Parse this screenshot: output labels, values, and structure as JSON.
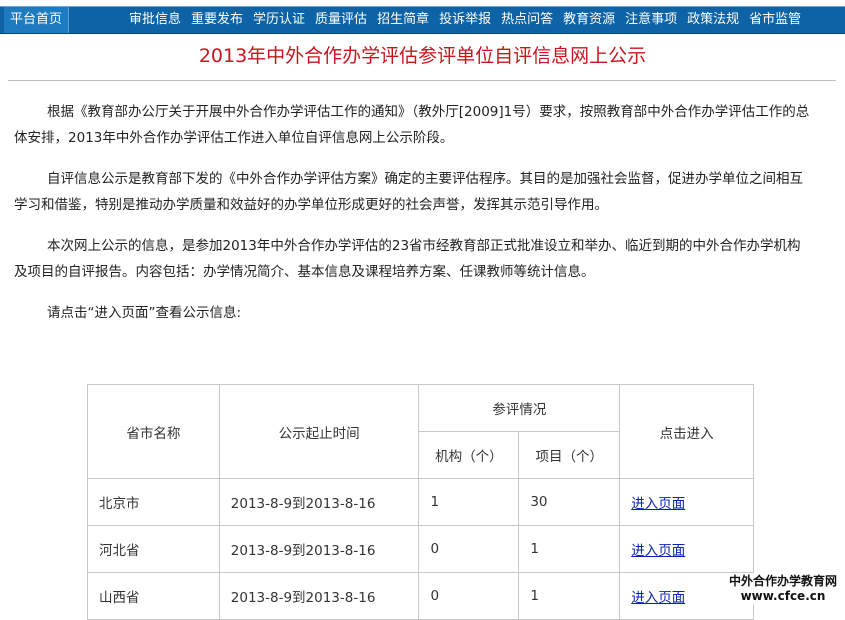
{
  "nav": {
    "home": "平台首页",
    "items": [
      "审批信息",
      "重要发布",
      "学历认证",
      "质量评估",
      "招生简章",
      "投诉举报",
      "热点问答",
      "教育资源",
      "注意事项",
      "政策法规",
      "省市监管"
    ]
  },
  "title": "2013年中外合作办学评估参评单位自评信息网上公示",
  "paragraphs": [
    "根据《教育部办公厅关于开展中外合作办学评估工作的通知》（教外厅[2009]1号）要求，按照教育部中外合作办学评估工作的总体安排，2013年中外合作办学评估工作进入单位自评信息网上公示阶段。",
    "自评信息公示是教育部下发的《中外合作办学评估方案》确定的主要评估程序。其目的是加强社会监督，促进办学单位之间相互学习和借鉴，特别是推动办学质量和效益好的办学单位形成更好的社会声誉，发挥其示范引导作用。",
    "本次网上公示的信息，是参加2013年中外合作办学评估的23省市经教育部正式批准设立和举办、临近到期的中外合作办学机构及项目的自评报告。内容包括：办学情况简介、基本信息及课程培养方案、任课教师等统计信息。",
    "请点击“进入页面”查看公示信息:"
  ],
  "table": {
    "header": {
      "province": "省市名称",
      "period": "公示起止时间",
      "participation": "参评情况",
      "institutions": "机构（个）",
      "projects": "项目（个）",
      "enter": "点击进入"
    },
    "rows": [
      {
        "province": "北京市",
        "period": "2013-8-9到2013-8-16",
        "institutions": "1",
        "projects": "30",
        "link": "进入页面"
      },
      {
        "province": "河北省",
        "period": "2013-8-9到2013-8-16",
        "institutions": "0",
        "projects": "1",
        "link": "进入页面"
      },
      {
        "province": "山西省",
        "period": "2013-8-9到2013-8-16",
        "institutions": "0",
        "projects": "1",
        "link": "进入页面"
      }
    ]
  },
  "watermark": {
    "line1": "中外合作办学教育网",
    "line2": "www.cfce.cn"
  }
}
